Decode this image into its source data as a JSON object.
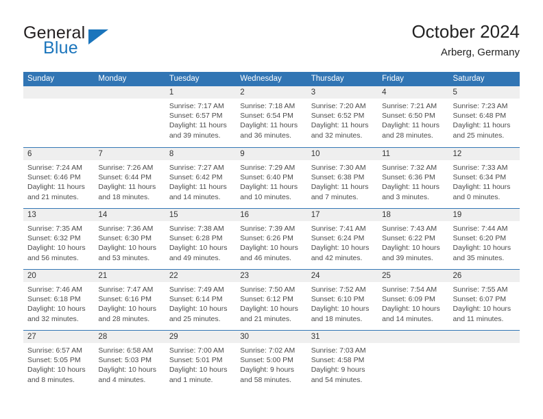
{
  "brand": {
    "name_top": "General",
    "name_bottom": "Blue",
    "logo_icon": "triangle-flag-icon",
    "color_dark": "#231f20",
    "color_blue": "#1b75bc"
  },
  "header": {
    "title": "October 2024",
    "subtitle": "Arberg, Germany"
  },
  "theme": {
    "header_band": "#3175b4",
    "date_band": "#efefef",
    "text": "#4a4a4a"
  },
  "calendar": {
    "weekdays": [
      "Sunday",
      "Monday",
      "Tuesday",
      "Wednesday",
      "Thursday",
      "Friday",
      "Saturday"
    ],
    "labels": {
      "sunrise": "Sunrise:",
      "sunset": "Sunset:",
      "daylight": "Daylight:"
    },
    "weeks": [
      [
        {
          "day": ""
        },
        {
          "day": ""
        },
        {
          "day": "1",
          "sunrise": "Sunrise: 7:17 AM",
          "sunset": "Sunset: 6:57 PM",
          "daylight_line1": "Daylight: 11 hours",
          "daylight_line2": "and 39 minutes."
        },
        {
          "day": "2",
          "sunrise": "Sunrise: 7:18 AM",
          "sunset": "Sunset: 6:54 PM",
          "daylight_line1": "Daylight: 11 hours",
          "daylight_line2": "and 36 minutes."
        },
        {
          "day": "3",
          "sunrise": "Sunrise: 7:20 AM",
          "sunset": "Sunset: 6:52 PM",
          "daylight_line1": "Daylight: 11 hours",
          "daylight_line2": "and 32 minutes."
        },
        {
          "day": "4",
          "sunrise": "Sunrise: 7:21 AM",
          "sunset": "Sunset: 6:50 PM",
          "daylight_line1": "Daylight: 11 hours",
          "daylight_line2": "and 28 minutes."
        },
        {
          "day": "5",
          "sunrise": "Sunrise: 7:23 AM",
          "sunset": "Sunset: 6:48 PM",
          "daylight_line1": "Daylight: 11 hours",
          "daylight_line2": "and 25 minutes."
        }
      ],
      [
        {
          "day": "6",
          "sunrise": "Sunrise: 7:24 AM",
          "sunset": "Sunset: 6:46 PM",
          "daylight_line1": "Daylight: 11 hours",
          "daylight_line2": "and 21 minutes."
        },
        {
          "day": "7",
          "sunrise": "Sunrise: 7:26 AM",
          "sunset": "Sunset: 6:44 PM",
          "daylight_line1": "Daylight: 11 hours",
          "daylight_line2": "and 18 minutes."
        },
        {
          "day": "8",
          "sunrise": "Sunrise: 7:27 AM",
          "sunset": "Sunset: 6:42 PM",
          "daylight_line1": "Daylight: 11 hours",
          "daylight_line2": "and 14 minutes."
        },
        {
          "day": "9",
          "sunrise": "Sunrise: 7:29 AM",
          "sunset": "Sunset: 6:40 PM",
          "daylight_line1": "Daylight: 11 hours",
          "daylight_line2": "and 10 minutes."
        },
        {
          "day": "10",
          "sunrise": "Sunrise: 7:30 AM",
          "sunset": "Sunset: 6:38 PM",
          "daylight_line1": "Daylight: 11 hours",
          "daylight_line2": "and 7 minutes."
        },
        {
          "day": "11",
          "sunrise": "Sunrise: 7:32 AM",
          "sunset": "Sunset: 6:36 PM",
          "daylight_line1": "Daylight: 11 hours",
          "daylight_line2": "and 3 minutes."
        },
        {
          "day": "12",
          "sunrise": "Sunrise: 7:33 AM",
          "sunset": "Sunset: 6:34 PM",
          "daylight_line1": "Daylight: 11 hours",
          "daylight_line2": "and 0 minutes."
        }
      ],
      [
        {
          "day": "13",
          "sunrise": "Sunrise: 7:35 AM",
          "sunset": "Sunset: 6:32 PM",
          "daylight_line1": "Daylight: 10 hours",
          "daylight_line2": "and 56 minutes."
        },
        {
          "day": "14",
          "sunrise": "Sunrise: 7:36 AM",
          "sunset": "Sunset: 6:30 PM",
          "daylight_line1": "Daylight: 10 hours",
          "daylight_line2": "and 53 minutes."
        },
        {
          "day": "15",
          "sunrise": "Sunrise: 7:38 AM",
          "sunset": "Sunset: 6:28 PM",
          "daylight_line1": "Daylight: 10 hours",
          "daylight_line2": "and 49 minutes."
        },
        {
          "day": "16",
          "sunrise": "Sunrise: 7:39 AM",
          "sunset": "Sunset: 6:26 PM",
          "daylight_line1": "Daylight: 10 hours",
          "daylight_line2": "and 46 minutes."
        },
        {
          "day": "17",
          "sunrise": "Sunrise: 7:41 AM",
          "sunset": "Sunset: 6:24 PM",
          "daylight_line1": "Daylight: 10 hours",
          "daylight_line2": "and 42 minutes."
        },
        {
          "day": "18",
          "sunrise": "Sunrise: 7:43 AM",
          "sunset": "Sunset: 6:22 PM",
          "daylight_line1": "Daylight: 10 hours",
          "daylight_line2": "and 39 minutes."
        },
        {
          "day": "19",
          "sunrise": "Sunrise: 7:44 AM",
          "sunset": "Sunset: 6:20 PM",
          "daylight_line1": "Daylight: 10 hours",
          "daylight_line2": "and 35 minutes."
        }
      ],
      [
        {
          "day": "20",
          "sunrise": "Sunrise: 7:46 AM",
          "sunset": "Sunset: 6:18 PM",
          "daylight_line1": "Daylight: 10 hours",
          "daylight_line2": "and 32 minutes."
        },
        {
          "day": "21",
          "sunrise": "Sunrise: 7:47 AM",
          "sunset": "Sunset: 6:16 PM",
          "daylight_line1": "Daylight: 10 hours",
          "daylight_line2": "and 28 minutes."
        },
        {
          "day": "22",
          "sunrise": "Sunrise: 7:49 AM",
          "sunset": "Sunset: 6:14 PM",
          "daylight_line1": "Daylight: 10 hours",
          "daylight_line2": "and 25 minutes."
        },
        {
          "day": "23",
          "sunrise": "Sunrise: 7:50 AM",
          "sunset": "Sunset: 6:12 PM",
          "daylight_line1": "Daylight: 10 hours",
          "daylight_line2": "and 21 minutes."
        },
        {
          "day": "24",
          "sunrise": "Sunrise: 7:52 AM",
          "sunset": "Sunset: 6:10 PM",
          "daylight_line1": "Daylight: 10 hours",
          "daylight_line2": "and 18 minutes."
        },
        {
          "day": "25",
          "sunrise": "Sunrise: 7:54 AM",
          "sunset": "Sunset: 6:09 PM",
          "daylight_line1": "Daylight: 10 hours",
          "daylight_line2": "and 14 minutes."
        },
        {
          "day": "26",
          "sunrise": "Sunrise: 7:55 AM",
          "sunset": "Sunset: 6:07 PM",
          "daylight_line1": "Daylight: 10 hours",
          "daylight_line2": "and 11 minutes."
        }
      ],
      [
        {
          "day": "27",
          "sunrise": "Sunrise: 6:57 AM",
          "sunset": "Sunset: 5:05 PM",
          "daylight_line1": "Daylight: 10 hours",
          "daylight_line2": "and 8 minutes."
        },
        {
          "day": "28",
          "sunrise": "Sunrise: 6:58 AM",
          "sunset": "Sunset: 5:03 PM",
          "daylight_line1": "Daylight: 10 hours",
          "daylight_line2": "and 4 minutes."
        },
        {
          "day": "29",
          "sunrise": "Sunrise: 7:00 AM",
          "sunset": "Sunset: 5:01 PM",
          "daylight_line1": "Daylight: 10 hours",
          "daylight_line2": "and 1 minute."
        },
        {
          "day": "30",
          "sunrise": "Sunrise: 7:02 AM",
          "sunset": "Sunset: 5:00 PM",
          "daylight_line1": "Daylight: 9 hours",
          "daylight_line2": "and 58 minutes."
        },
        {
          "day": "31",
          "sunrise": "Sunrise: 7:03 AM",
          "sunset": "Sunset: 4:58 PM",
          "daylight_line1": "Daylight: 9 hours",
          "daylight_line2": "and 54 minutes."
        },
        {
          "day": ""
        },
        {
          "day": ""
        }
      ]
    ]
  }
}
